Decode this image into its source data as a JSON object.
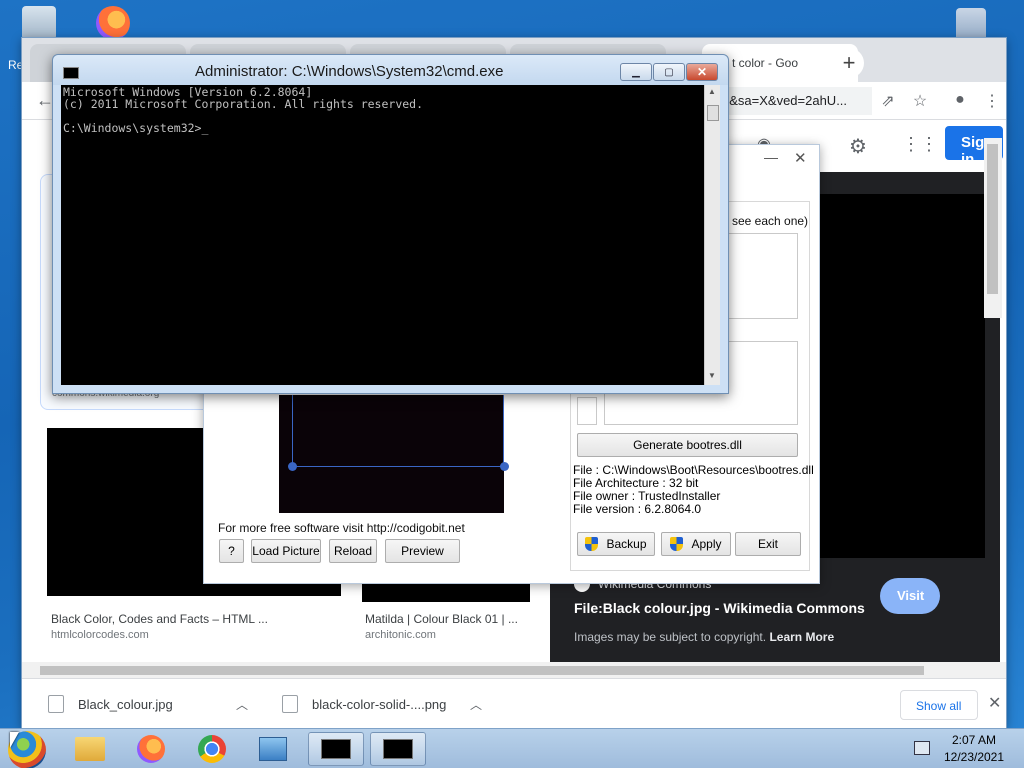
{
  "desktop": {
    "recycle_label_fragment": "Re"
  },
  "chrome": {
    "active_tab_title": "t color - Goo",
    "omnibox_text": "n&sa=X&ved=2ahU...",
    "signin_label": "Sign in",
    "results": [
      {
        "title": "Black Color, Codes and Facts – HTML ...",
        "site": "htmlcolorcodes.com"
      },
      {
        "title": "Matilda | Colour Black 01 | ...",
        "site": "architonic.com"
      }
    ],
    "result_box_site": "commons.wikimedia.org",
    "preview": {
      "site": "Wikimedia Commons",
      "title": "File:Black colour.jpg - Wikimedia Commons",
      "copyright": "Images may be subject to copyright.",
      "learn_more": "Learn More",
      "visit_label": "Visit"
    },
    "downloads": [
      {
        "name": "Black_colour.jpg"
      },
      {
        "name": "black-color-solid-....png"
      }
    ],
    "show_all_label": "Show all"
  },
  "app": {
    "hint_text": "see each one)",
    "free_software_text": "For more free software visit  http://codigobit.net",
    "buttons": {
      "help": "?",
      "load_picture": "Load Picture",
      "reload": "Reload",
      "preview": "Preview",
      "generate": "Generate bootres.dll",
      "backup": "Backup",
      "apply": "Apply",
      "exit": "Exit"
    },
    "file_info": {
      "file": "File : C:\\Windows\\Boot\\Resources\\bootres.dll",
      "architecture": "File Architecture : 32 bit",
      "owner": "File owner : TrustedInstaller",
      "version": "File version : 6.2.8064.0"
    }
  },
  "cmd": {
    "title": "Administrator: C:\\Windows\\System32\\cmd.exe",
    "lines": "Microsoft Windows [Version 6.2.8064]\n(c) 2011 Microsoft Corporation. All rights reserved.\n\nC:\\Windows\\system32>_"
  },
  "taskbar": {
    "time": "2:07 AM",
    "date": "12/23/2021"
  }
}
